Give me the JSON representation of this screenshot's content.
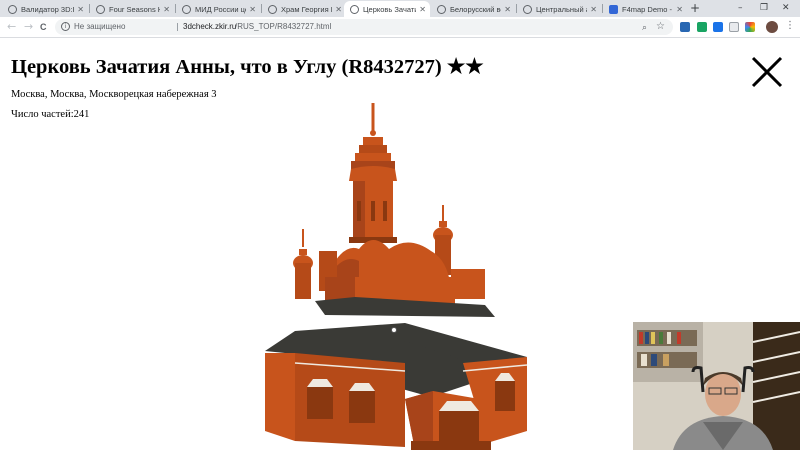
{
  "browser": {
    "tabs": [
      {
        "label": "Валидатор 3D:RUS",
        "active": false
      },
      {
        "label": "Four Seasons Hote",
        "active": false
      },
      {
        "label": "МИД России цен",
        "active": false
      },
      {
        "label": "Храм Георгия По",
        "active": false
      },
      {
        "label": "Церковь Зачатия",
        "active": true
      },
      {
        "label": "Белорусский вокз",
        "active": false
      },
      {
        "label": "Центральный ак",
        "active": false
      },
      {
        "label": "F4map Demo - Int",
        "active": false
      }
    ],
    "new_tab": "+",
    "window_controls": {
      "minimize": "–",
      "restore": "❐",
      "close": "✕"
    },
    "nav": {
      "back": "←",
      "forward": "→",
      "reload": "C"
    },
    "address_bar": {
      "security_label": "Не защищено",
      "host": "3dcheck.zkir.ru",
      "path": "/RUS_TOP/R8432727.html"
    }
  },
  "page": {
    "title": "Церковь Зачатия Анны, что в Углу (R8432727) ★★",
    "address": "Москва, Москва, Москворецкая набережная 3",
    "parts_label": "Число частей:",
    "parts_count": "241",
    "close_icon": "close-icon"
  },
  "colors": {
    "facade": "#c8541c",
    "facade_dark": "#8a3810",
    "roof": "#3a3a36",
    "trim": "#efe9e0",
    "tab_strip": "#dee1e6"
  }
}
